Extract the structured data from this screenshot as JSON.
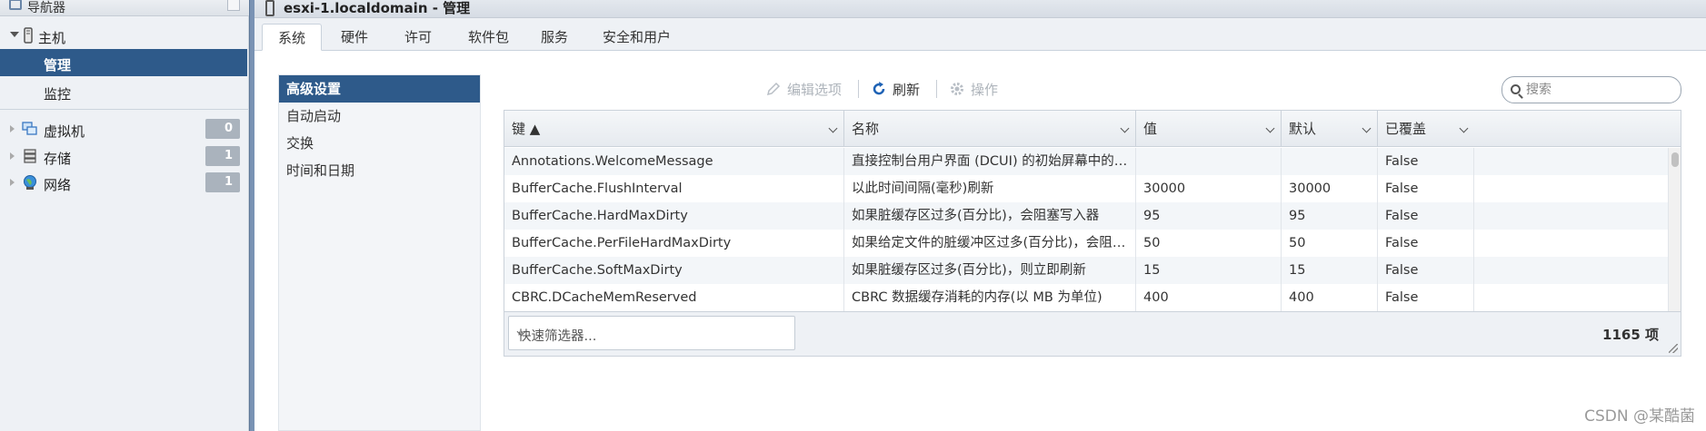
{
  "navigator": {
    "title": "导航器",
    "tree": {
      "host_label": "主机",
      "manage_label": "管理",
      "monitor_label": "监控",
      "vms_label": "虚拟机",
      "vms_count": "0",
      "storage_label": "存储",
      "storage_count": "1",
      "network_label": "网络",
      "network_count": "1"
    }
  },
  "page": {
    "title": "esxi-1.localdomain - 管理"
  },
  "tabs": [
    "系统",
    "硬件",
    "许可",
    "软件包",
    "服务",
    "安全和用户"
  ],
  "active_tab": "系统",
  "submenu": [
    "高级设置",
    "自动启动",
    "交换",
    "时间和日期"
  ],
  "active_submenu": "高级设置",
  "toolbar": {
    "edit_label": "编辑选项",
    "refresh_label": "刷新",
    "actions_label": "操作",
    "search_placeholder": "搜索"
  },
  "grid": {
    "columns": [
      "键 ▲",
      "名称",
      "值",
      "默认",
      "已覆盖"
    ],
    "rows": [
      [
        "Annotations.WelcomeMessage",
        "直接控制台用户界面 (DCUI) 的初始屏幕中的欢迎消息",
        "",
        "",
        "False"
      ],
      [
        "BufferCache.FlushInterval",
        "以此时间间隔(毫秒)刷新",
        "30000",
        "30000",
        "False"
      ],
      [
        "BufferCache.HardMaxDirty",
        "如果脏缓存区过多(百分比)，会阻塞写入器",
        "95",
        "95",
        "False"
      ],
      [
        "BufferCache.PerFileHardMaxDirty",
        "如果给定文件的脏缓冲区过多(百分比)，会阻塞写入器",
        "50",
        "50",
        "False"
      ],
      [
        "BufferCache.SoftMaxDirty",
        "如果脏缓存区过多(百分比)，则立即刷新",
        "15",
        "15",
        "False"
      ],
      [
        "CBRC.DCacheMemReserved",
        "CBRC 数据缓存消耗的内存(以 MB 为单位)",
        "400",
        "400",
        "False"
      ]
    ],
    "quick_filter_placeholder": "快速筛选器...",
    "item_count": "1165 项"
  },
  "watermark": "CSDN @某酷菌",
  "colors": {
    "selected_bg": "#2e5a8a",
    "nav_bg": "#eef1f5",
    "splitter": "#7a93b4",
    "refresh_icon": "#1f63b5",
    "badge_bg": "#aab3bd"
  }
}
